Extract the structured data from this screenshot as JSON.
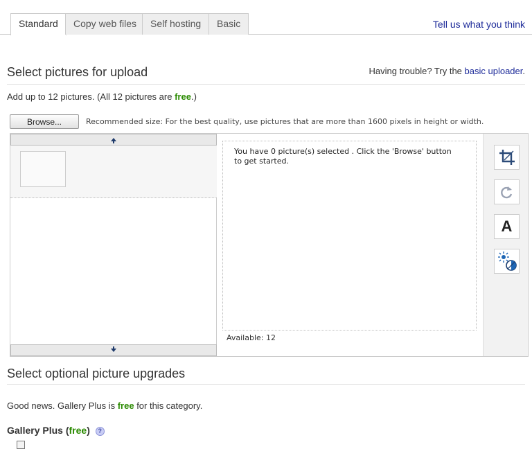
{
  "tabs": [
    {
      "label": "Standard",
      "active": true
    },
    {
      "label": "Copy web files",
      "active": false
    },
    {
      "label": "Self hosting",
      "active": false
    },
    {
      "label": "Basic",
      "active": false
    }
  ],
  "feedback_link": "Tell us what you think",
  "upload_section": {
    "title": "Select pictures for upload",
    "trouble_prefix": "Having trouble? Try the",
    "trouble_link": "basic uploader",
    "trouble_suffix": ".",
    "add_prefix": "Add up to 12 pictures. (All 12 pictures are",
    "add_free": "free",
    "add_suffix": ".)",
    "browse_label": "Browse...",
    "recommended": "Recommended size: For the best quality, use pictures that are more than 1600 pixels in height or width.",
    "preview_message": "You have 0 picture(s) selected . Click the 'Browse' button to get started.",
    "available": "Available: 12",
    "tools": [
      {
        "icon": "crop-icon"
      },
      {
        "icon": "rotate-icon"
      },
      {
        "icon": "text-icon",
        "glyph": "A"
      },
      {
        "icon": "auto-enhance-icon"
      }
    ]
  },
  "upgrades_section": {
    "title": "Select optional picture upgrades",
    "goodnews_prefix": "Good news. Gallery Plus is",
    "goodnews_free": "free",
    "goodnews_suffix": "for this category.",
    "gallery_plus_label": "Gallery Plus",
    "gallery_plus_free": "free",
    "help_glyph": "?"
  },
  "colors": {
    "link": "#1c2a99",
    "free": "#2a8a00",
    "arrow": "#1f3b6b"
  }
}
